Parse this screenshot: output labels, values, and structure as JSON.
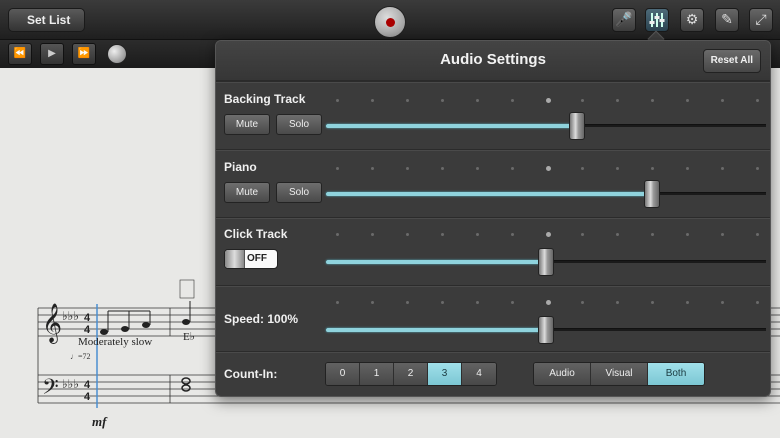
{
  "toolbar": {
    "set_list_label": "Set List",
    "icons": [
      "microphone-icon",
      "mixer-icon",
      "gear-icon",
      "pencil-icon",
      "expand-icon"
    ]
  },
  "transport": {
    "buttons": [
      "rewind",
      "play",
      "fast-forward"
    ]
  },
  "sheet": {
    "tempo_text": "Moderately slow",
    "metronome_text": "♩=72",
    "chord_symbol": "E♭",
    "dynamic": "mf"
  },
  "panel": {
    "title": "Audio Settings",
    "reset_label": "Reset All",
    "backing_track": {
      "label": "Backing Track",
      "mute": "Mute",
      "solo": "Solo",
      "level": 0.57
    },
    "piano": {
      "label": "Piano",
      "mute": "Mute",
      "solo": "Solo",
      "level": 0.74
    },
    "click_track": {
      "label": "Click Track",
      "toggle": "OFF",
      "level": 0.5
    },
    "speed": {
      "label": "Speed: 100%",
      "level": 0.5
    },
    "count_in": {
      "label": "Count-In:",
      "options": [
        "0",
        "1",
        "2",
        "3",
        "4"
      ],
      "selected": "3",
      "modes": [
        "Audio",
        "Visual",
        "Both"
      ],
      "selected_mode": "Both"
    }
  },
  "colors": {
    "accent": "#8fd3dd",
    "panel_bg": "#3b3b3b"
  }
}
